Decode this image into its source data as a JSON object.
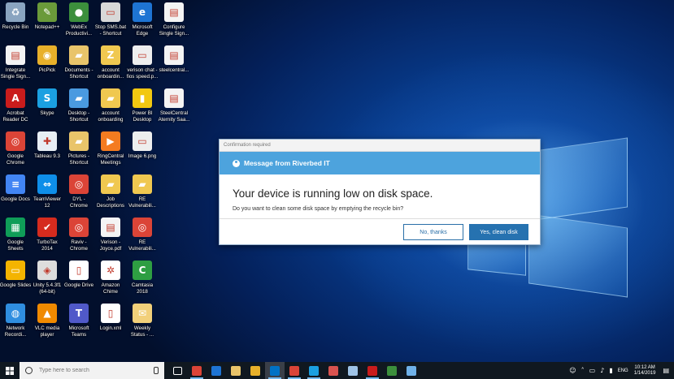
{
  "desktop": {
    "icons": [
      {
        "label": "Recycle Bin",
        "icon": "recycle-bin-icon",
        "color": "#8aa4c0",
        "glyph": "♻"
      },
      {
        "label": "Notepad++",
        "icon": "notepad-plus-plus-icon",
        "color": "#6a9a3a",
        "glyph": "✎"
      },
      {
        "label": "WebEx\nProductivi...",
        "icon": "webex-icon",
        "color": "#3c8f3c",
        "glyph": "●"
      },
      {
        "label": "Stop SMS.bat\n- Shortcut",
        "icon": "bat-file-icon",
        "color": "#d8d8d8",
        "glyph": "▭"
      },
      {
        "label": "Microsoft\nEdge",
        "icon": "edge-icon",
        "color": "#1e74d3",
        "glyph": "e"
      },
      {
        "label": "Configure\nSingle Sign...",
        "icon": "pdf-icon",
        "color": "#f4f4f4",
        "glyph": "▤"
      },
      {
        "label": "Integrate\nSingle Sign...",
        "icon": "pdf-icon",
        "color": "#f4f4f4",
        "glyph": "▤"
      },
      {
        "label": "PicPick",
        "icon": "picpick-icon",
        "color": "#e8b02a",
        "glyph": "◉"
      },
      {
        "label": "Documents -\nShortcut",
        "icon": "documents-folder-icon",
        "color": "#e9c46a",
        "glyph": "▰"
      },
      {
        "label": "account\nonboardin...",
        "icon": "zip-folder-icon",
        "color": "#f0c850",
        "glyph": "Z"
      },
      {
        "label": "verison chat -\nfios speed.p...",
        "icon": "image-file-icon",
        "color": "#eeeeee",
        "glyph": "▭"
      },
      {
        "label": "steelcentral...",
        "icon": "pdf-icon",
        "color": "#f4f4f4",
        "glyph": "▤"
      },
      {
        "label": "Acrobat\nReader DC",
        "icon": "acrobat-icon",
        "color": "#c91c1c",
        "glyph": "A"
      },
      {
        "label": "Skype",
        "icon": "skype-icon",
        "color": "#1ba0e1",
        "glyph": "S"
      },
      {
        "label": "Desktop -\nShortcut",
        "icon": "desktop-folder-icon",
        "color": "#4a9ae0",
        "glyph": "▰"
      },
      {
        "label": "account\nonboarding",
        "icon": "folder-icon",
        "color": "#f0c850",
        "glyph": "▰"
      },
      {
        "label": "Power BI\nDesktop",
        "icon": "powerbi-icon",
        "color": "#f2c811",
        "glyph": "▮"
      },
      {
        "label": "SteelCentral\nAternity Saa...",
        "icon": "pdf-icon",
        "color": "#f4f4f4",
        "glyph": "▤"
      },
      {
        "label": "Google\nChrome",
        "icon": "chrome-icon",
        "color": "#db4437",
        "glyph": "◎"
      },
      {
        "label": "Tableau 9.3",
        "icon": "tableau-icon",
        "color": "#e8eef4",
        "glyph": "✚"
      },
      {
        "label": "Pictures -\nShortcut",
        "icon": "pictures-folder-icon",
        "color": "#e9c46a",
        "glyph": "▰"
      },
      {
        "label": "RingCentral\nMeetings",
        "icon": "ringcentral-icon",
        "color": "#f47b20",
        "glyph": "▶"
      },
      {
        "label": "Image 6.png",
        "icon": "image-file-icon",
        "color": "#eeeeee",
        "glyph": "▭"
      },
      {
        "label": "Google Docs",
        "icon": "google-docs-icon",
        "color": "#4285f4",
        "glyph": "≡"
      },
      {
        "label": "TeamViewer\n12",
        "icon": "teamviewer-icon",
        "color": "#0e8ee9",
        "glyph": "⇔"
      },
      {
        "label": "DYL -\nChrome",
        "icon": "chrome-icon",
        "color": "#db4437",
        "glyph": "◎"
      },
      {
        "label": "Job\nDescriptions",
        "icon": "folder-icon",
        "color": "#f0c850",
        "glyph": "▰"
      },
      {
        "label": "RE\nVulnerabili...",
        "icon": "folder-icon",
        "color": "#f0c850",
        "glyph": "▰"
      },
      {
        "label": "Google\nSheets",
        "icon": "google-sheets-icon",
        "color": "#0f9d58",
        "glyph": "▦"
      },
      {
        "label": "TurboTax\n2014",
        "icon": "turbotax-icon",
        "color": "#d52b1e",
        "glyph": "✔"
      },
      {
        "label": "Raviv -\nChrome",
        "icon": "chrome-icon",
        "color": "#db4437",
        "glyph": "◎"
      },
      {
        "label": "Verison -\nJoyce.pdf",
        "icon": "pdf-icon",
        "color": "#f4f4f4",
        "glyph": "▤"
      },
      {
        "label": "RE\nVulnerabili...",
        "icon": "chrome-icon",
        "color": "#db4437",
        "glyph": "◎"
      },
      {
        "label": "Google Slides",
        "icon": "google-slides-icon",
        "color": "#f4b400",
        "glyph": "▭"
      },
      {
        "label": "Unity 5.4.3f1\n(64-bit)",
        "icon": "unity-icon",
        "color": "#dddddd",
        "glyph": "◈"
      },
      {
        "label": "Google Drive",
        "icon": "document-icon",
        "color": "#ffffff",
        "glyph": "▯"
      },
      {
        "label": "Amazon\nChime",
        "icon": "amazon-chime-icon",
        "color": "#ffffff",
        "glyph": "✲"
      },
      {
        "label": "Camtasia\n2018",
        "icon": "camtasia-icon",
        "color": "#2e9e42",
        "glyph": "C"
      },
      {
        "label": "Network\nRecordi...",
        "icon": "network-recording-icon",
        "color": "#2f8ee0",
        "glyph": "◍"
      },
      {
        "label": "VLC media\nplayer",
        "icon": "vlc-icon",
        "color": "#f08a00",
        "glyph": "▲"
      },
      {
        "label": "Microsoft\nTeams",
        "icon": "teams-icon",
        "color": "#5059c9",
        "glyph": "T"
      },
      {
        "label": "Login.xml",
        "icon": "document-icon",
        "color": "#ffffff",
        "glyph": "▯"
      },
      {
        "label": "Weekly\nStatus - ...",
        "icon": "email-icon",
        "color": "#f2d07a",
        "glyph": "✉"
      }
    ]
  },
  "dialog": {
    "window_title": "Confirmation required",
    "banner": "Message from Riverbed IT",
    "headline": "Your device is running low on disk space.",
    "body": "Do you want to clean some disk space by emptying the recycle bin?",
    "decline_label": "No, thanks",
    "accept_label": "Yes, clean disk"
  },
  "taskbar": {
    "search_placeholder": "Type here to search",
    "apps": [
      {
        "icon": "task-view-icon",
        "color": "#ffffff",
        "state": "idle"
      },
      {
        "icon": "chrome-icon",
        "color": "#db4437",
        "state": "running"
      },
      {
        "icon": "edge-icon",
        "color": "#1e74d3",
        "state": "idle"
      },
      {
        "icon": "file-explorer-icon",
        "color": "#e9c46a",
        "state": "idle"
      },
      {
        "icon": "picpick-icon",
        "color": "#e8b02a",
        "state": "idle"
      },
      {
        "icon": "outlook-icon",
        "color": "#0072c6",
        "state": "active"
      },
      {
        "icon": "chrome-icon",
        "color": "#db4437",
        "state": "running"
      },
      {
        "icon": "skype-icon",
        "color": "#1ba0e1",
        "state": "running"
      },
      {
        "icon": "snipping-tool-icon",
        "color": "#d9534f",
        "state": "idle"
      },
      {
        "icon": "notepad-icon",
        "color": "#9ec3e6",
        "state": "idle"
      },
      {
        "icon": "acrobat-icon",
        "color": "#c91c1c",
        "state": "running"
      },
      {
        "icon": "webex-icon",
        "color": "#3c8f3c",
        "state": "idle"
      },
      {
        "icon": "remote-desktop-icon",
        "color": "#6fb1e8",
        "state": "idle"
      }
    ],
    "tray": {
      "language": "ENG",
      "time": "10:12 AM",
      "date": "1/14/2019"
    }
  }
}
